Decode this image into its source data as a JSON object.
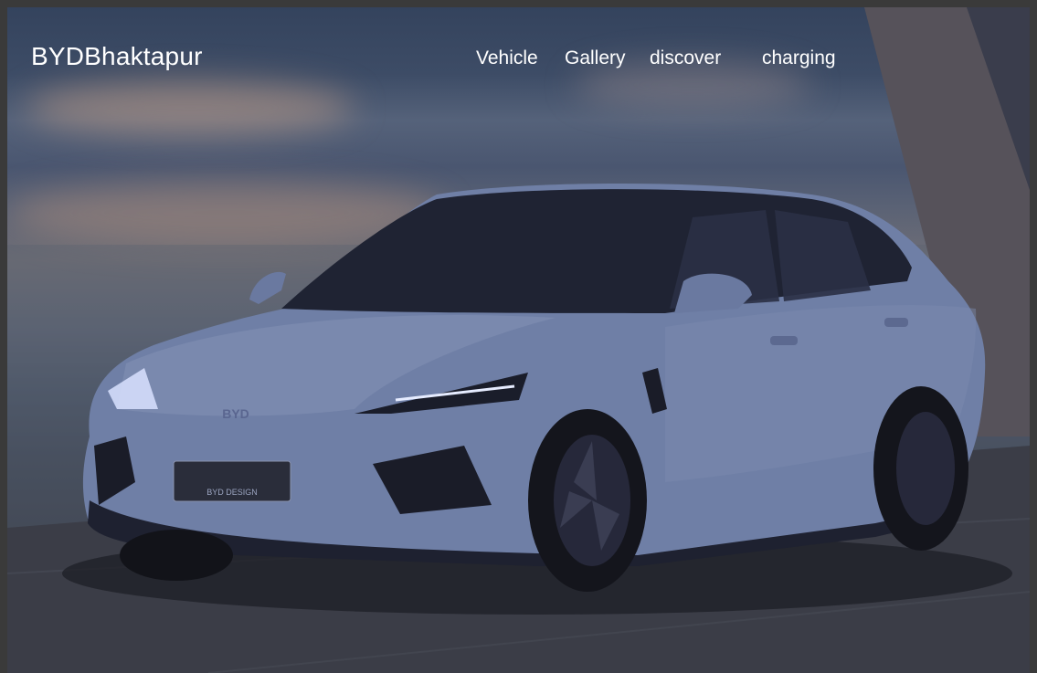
{
  "header": {
    "brand": "BYDBhaktapur",
    "nav": [
      {
        "label": "Vehicle"
      },
      {
        "label": "Gallery"
      },
      {
        "label": "discover"
      },
      {
        "label": "charging"
      }
    ]
  },
  "hero": {
    "image": "car-photo",
    "plate_text": "BYD DESIGN",
    "logo_text": "BYD"
  },
  "colors": {
    "nav_text": "#ffffff",
    "frame": "#3a3a3a",
    "car_body": "#6f7fa6"
  }
}
